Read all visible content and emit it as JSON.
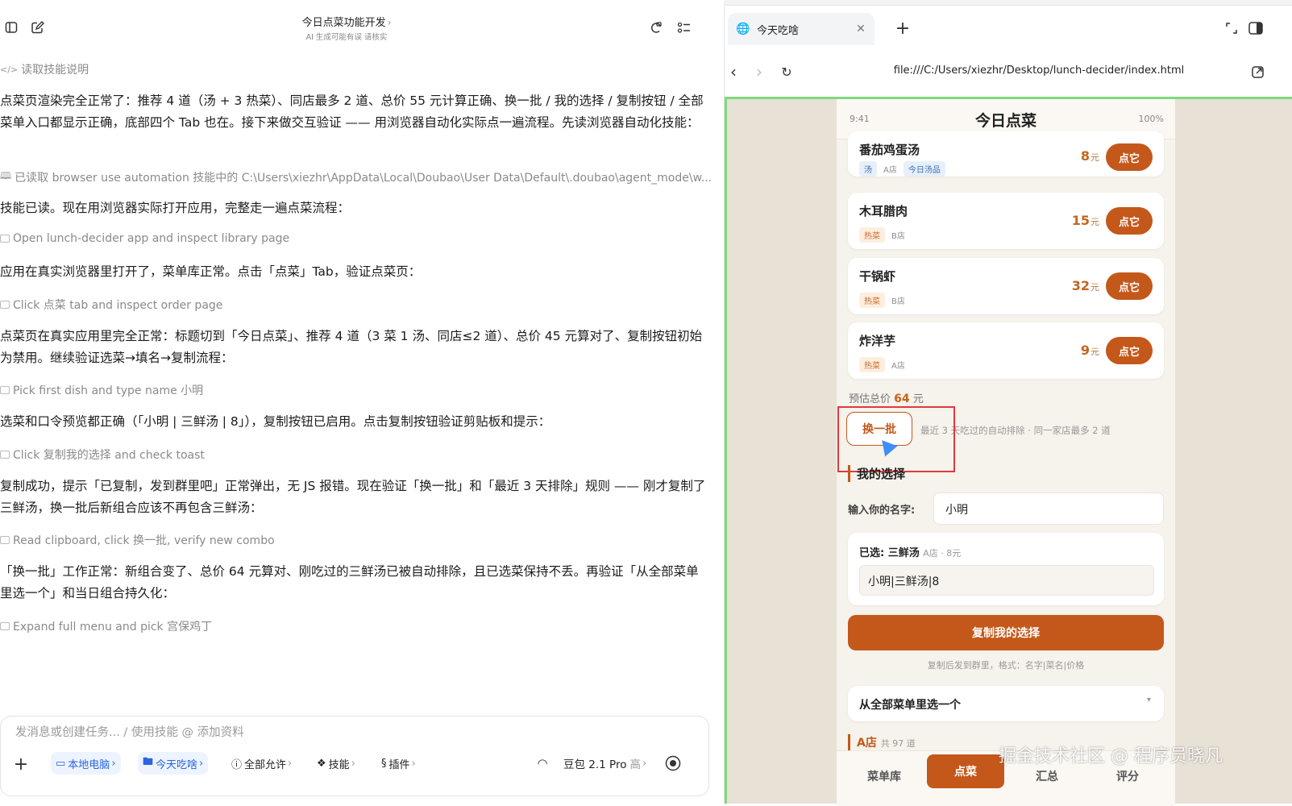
{
  "left_header": {
    "title": "今日点菜功能开发",
    "title_chevron": "›",
    "subtitle": "AI 生成可能有误 请核实"
  },
  "conversation": {
    "read_skill_label": "读取技能说明",
    "messages": [
      "点菜页渲染完全正常了：推荐 4 道（汤 + 3 热菜）、同店最多 2 道、总价 55 元计算正确、换一批 / 我的选择 / 复制按钮 / 全部菜单入口都显示正确，底部四个 Tab 也在。接下来做交互验证 —— 用浏览器自动化实际点一遍流程。先读浏览器自动化技能：",
      "技能已读。现在用浏览器实际打开应用，完整走一遍点菜流程：",
      "应用在真实浏览器里打开了，菜单库正常。点击「点菜」Tab，验证点菜页：",
      "点菜页在真实应用里完全正常：标题切到「今日点菜」、推荐 4 道（3 菜 1 汤、同店≤2 道）、总价 45 元算对了、复制按钮初始为禁用。继续验证选菜→填名→复制流程：",
      "选菜和口令预览都正确（「小明 | 三鲜汤 | 8」），复制按钮已启用。点击复制按钮验证剪贴板和提示：",
      "复制成功，提示「已复制，发到群里吧」正常弹出，无 JS 报错。现在验证「换一批」和「最近 3 天排除」规则 —— 刚才复制了三鲜汤，换一批后新组合应该不再包含三鲜汤：",
      "「换一批」工作正常：新组合变了、总价 64 元算对、刚吃过的三鲜汤已被自动排除，且已选菜保持不丢。再验证「从全部菜单里选一个」和当日组合持久化："
    ],
    "steps": [
      "已读取 browser use automation 技能中的 C:\\Users\\xiezhr\\AppData\\Local\\Doubao\\User Data\\Default\\.doubao\\agent_mode\\w...",
      "Open lunch-decider app and inspect library page",
      "Click 点菜 tab and inspect order page",
      "Pick first dish and type name 小明",
      "Click 复制我的选择 and check toast",
      "Read clipboard, click 换一批, verify new combo",
      "Expand full menu and pick 宫保鸡丁"
    ]
  },
  "composer": {
    "placeholder": "发消息或创建任务... / 使用技能 @ 添加资料",
    "chips": {
      "local": "本地电脑",
      "folder": "今天吃啥",
      "permission": "全部允许",
      "skills": "技能",
      "plugins": "插件",
      "model": "豆包 2.1 Pro",
      "model_level": "高"
    }
  },
  "browser": {
    "tab_title": "今天吃啥",
    "url": "file:///C:/Users/xiezhr/Desktop/lunch-decider/index.html"
  },
  "app": {
    "status_time": "9:41",
    "title": "今日点菜",
    "battery": "100%",
    "dishes": [
      {
        "name": "番茄鸡蛋汤",
        "tags": [
          "汤",
          "A店",
          "今日汤品"
        ],
        "price": "8",
        "unit": "元",
        "button": "点它"
      },
      {
        "name": "木耳腊肉",
        "tags": [
          "热菜",
          "B店"
        ],
        "price": "15",
        "unit": "元",
        "button": "点它"
      },
      {
        "name": "干锅虾",
        "tags": [
          "热菜",
          "B店"
        ],
        "price": "32",
        "unit": "元",
        "button": "点它"
      },
      {
        "name": "炸洋芋",
        "tags": [
          "热菜",
          "A店"
        ],
        "price": "9",
        "unit": "元",
        "button": "点它"
      }
    ],
    "total_prefix": "预估总价",
    "total_value": "64",
    "total_suffix": "元",
    "shuffle_button": "换一批",
    "shuffle_hint": "最近 3 天吃过的自动排除 · 同一家店最多 2 道",
    "my_choice_heading": "我的选择",
    "name_label": "输入你的名字:",
    "name_value": "小明",
    "selected_label": "已选: 三鲜汤",
    "selected_meta": "A店 · 8元",
    "command_preview": "小明|三鲜汤|8",
    "copy_button": "复制我的选择",
    "copy_hint": "复制后发到群里，格式：名字|菜名|价格",
    "full_menu_label": "从全部菜单里选一个",
    "shop_a_label": "A店",
    "shop_a_count": "共 97 道",
    "tabs": [
      "菜单库",
      "点菜",
      "汇总",
      "评分"
    ]
  },
  "watermark": "掘金技术社区 @ 程序员晓凡",
  "colors": {
    "accent": "#c4581a",
    "highlight_box": "#e03a3a",
    "viewport_border": "#7ddb7b"
  }
}
